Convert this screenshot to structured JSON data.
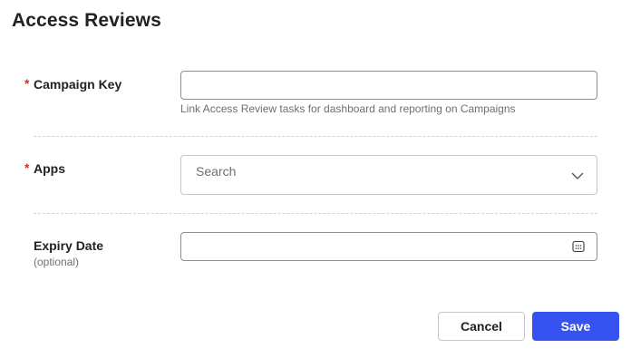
{
  "page": {
    "title": "Access Reviews"
  },
  "form": {
    "campaign_key": {
      "required_mark": "*",
      "label": "Campaign Key",
      "value": "",
      "help": "Link Access Review tasks for dashboard and reporting on Campaigns"
    },
    "apps": {
      "required_mark": "*",
      "label": "Apps",
      "placeholder": "Search",
      "icon": "chevron-down-icon"
    },
    "expiry_date": {
      "label": "Expiry Date",
      "optional": "(optional)",
      "value": "",
      "icon": "calendar-icon"
    }
  },
  "actions": {
    "cancel_label": "Cancel",
    "save_label": "Save"
  },
  "colors": {
    "primary": "#3653f0",
    "required": "#d0312d",
    "border": "#8c8c96",
    "muted_text": "#6e6e78"
  }
}
